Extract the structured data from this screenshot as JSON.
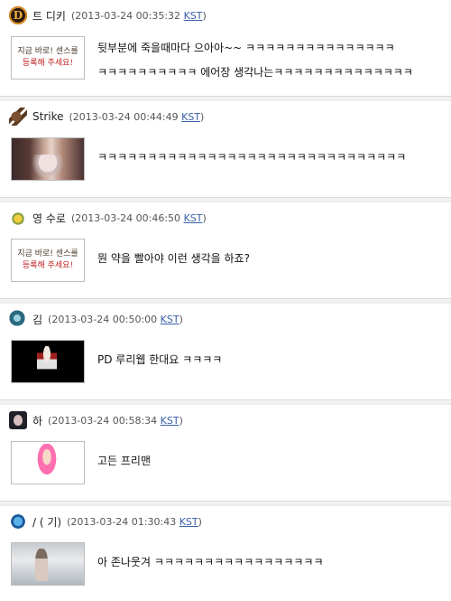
{
  "timezone_link": "KST",
  "comments": [
    {
      "nick": "트 디키",
      "time": "(2013-03-24 00:35:32",
      "icon": "diablo-d-icon",
      "thumb_lines": [
        "지금 바로! 센스를",
        "등록해 주세요!"
      ],
      "text_lines": [
        "뒷부분에 죽을때마다 으아아~~ ㅋㅋㅋㅋㅋㅋㅋㅋㅋㅋㅋㅋㅋㅋㅋ",
        "ㅋㅋㅋㅋㅋㅋㅋㅋㅋㅋ 에어장 생각나는ㅋㅋㅋㅋㅋㅋㅋㅋㅋㅋㅋㅋㅋㅋ"
      ]
    },
    {
      "nick": "Strike",
      "time": "(2013-03-24 00:44:49",
      "icon": "zerg-bug-icon",
      "thumb_lines": [],
      "text_lines": [
        "ㅋㅋㅋㅋㅋㅋㅋㅋㅋㅋㅋㅋㅋㅋㅋㅋㅋㅋㅋㅋㅋㅋㅋㅋㅋㅋㅋㅋㅋㅋㅋ"
      ]
    },
    {
      "nick": "영 수로",
      "time": "(2013-03-24 00:46:50",
      "icon": "star-icon",
      "thumb_lines": [
        "지금 바로! 센스를",
        "등록해 주세요!"
      ],
      "text_lines": [
        "뭔 약을 빨아야 이런 생각을 하죠?"
      ]
    },
    {
      "nick": "김",
      "time": "(2013-03-24 00:50:00",
      "icon": "sphere-icon",
      "thumb_lines": [],
      "text_lines": [
        "PD 루리웹 한대요 ㅋㅋㅋㅋ"
      ]
    },
    {
      "nick": "하",
      "time": "(2013-03-24 00:58:34",
      "icon": "face-icon",
      "thumb_lines": [],
      "text_lines": [
        "고든 프리맨"
      ]
    },
    {
      "nick": "/ (                  기)",
      "time": "(2013-03-24 01:30:43",
      "icon": "ball-icon",
      "thumb_lines": [],
      "text_lines": [
        "아 존나웃겨 ㅋㅋㅋㅋㅋㅋㅋㅋㅋㅋㅋㅋㅋㅋㅋㅋㅋ"
      ]
    }
  ]
}
